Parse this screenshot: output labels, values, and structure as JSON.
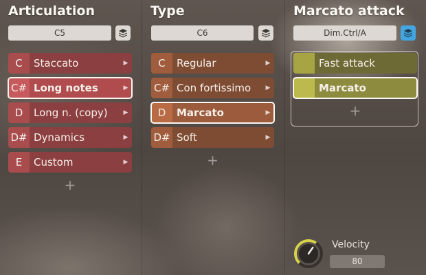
{
  "columns": [
    {
      "title": "Articulation",
      "key": "C5",
      "items": [
        {
          "note": "C",
          "label": "Staccato",
          "selected": false
        },
        {
          "note": "C#",
          "label": "Long notes",
          "selected": true
        },
        {
          "note": "D",
          "label": "Long n. (copy)",
          "selected": false
        },
        {
          "note": "D#",
          "label": "Dynamics",
          "selected": false
        },
        {
          "note": "E",
          "label": "Custom",
          "selected": false
        }
      ],
      "add_label": "+"
    },
    {
      "title": "Type",
      "key": "C6",
      "items": [
        {
          "note": "C",
          "label": "Regular",
          "selected": false
        },
        {
          "note": "C#",
          "label": "Con fortissimo",
          "selected": false
        },
        {
          "note": "D",
          "label": "Marcato",
          "selected": true
        },
        {
          "note": "D#",
          "label": "Soft",
          "selected": false
        }
      ],
      "add_label": "+"
    },
    {
      "title": "Marcato attack",
      "key": "Dim.Ctrl/A",
      "items": [
        {
          "note": "",
          "label": "Fast attack",
          "selected": false
        },
        {
          "note": "",
          "label": "Marcato",
          "selected": true
        }
      ],
      "add_label": "+"
    }
  ],
  "velocity": {
    "label": "Velocity",
    "value": "80",
    "level": 0.63
  },
  "colors": {
    "articulation": "#a94c4d",
    "type": "#a05d3d",
    "attack": "#a7a444",
    "stack_active": "#43a6e0",
    "knob_ring": "#d6d34a"
  }
}
